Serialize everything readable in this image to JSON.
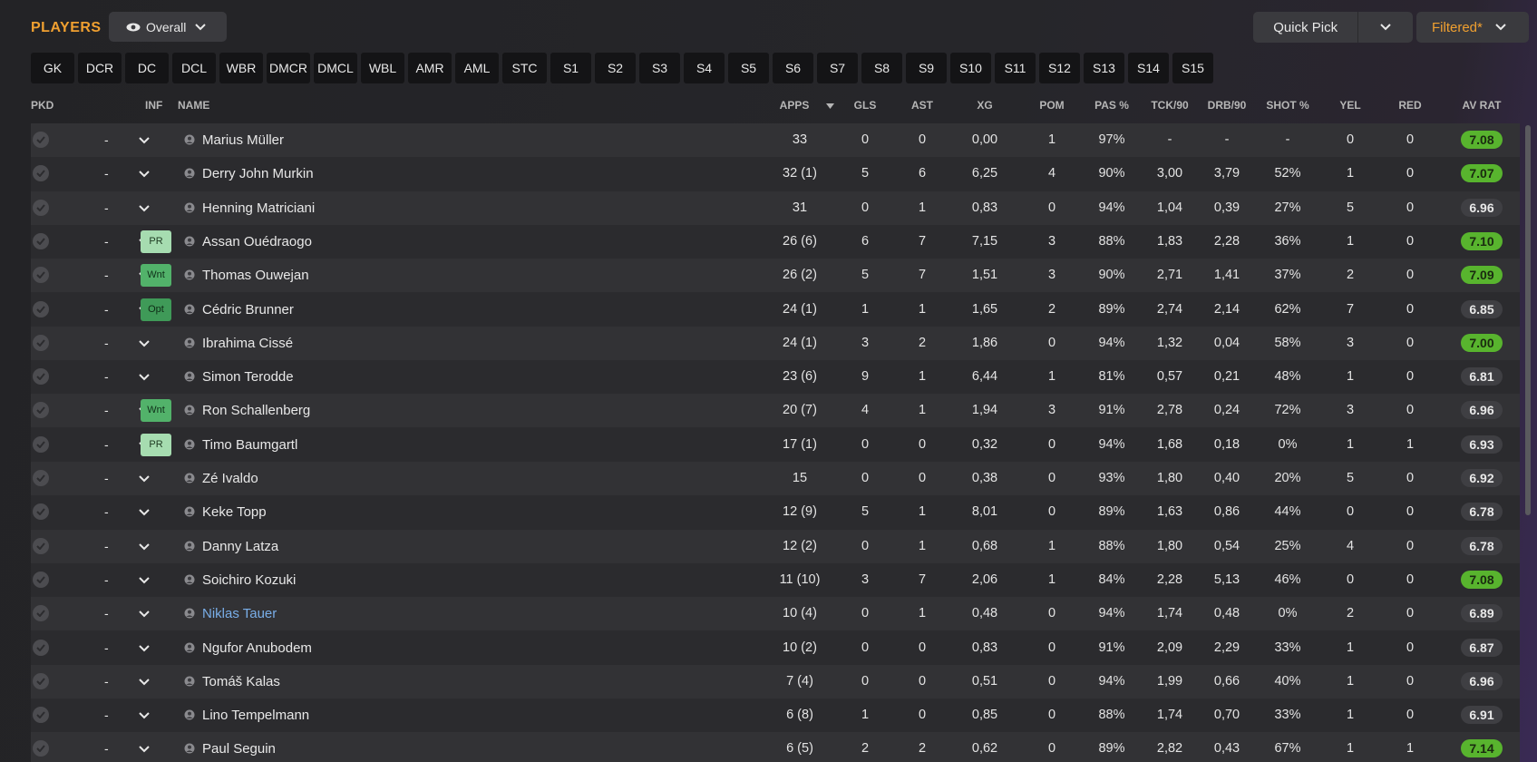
{
  "header": {
    "title": "PLAYERS",
    "view_label": "Overall",
    "quick_pick_label": "Quick Pick",
    "filter_label": "Filtered*"
  },
  "positions": [
    "GK",
    "DCR",
    "DC",
    "DCL",
    "WBR",
    "DMCR",
    "DMCL",
    "WBL",
    "AMR",
    "AML",
    "STC",
    "S1",
    "S2",
    "S3",
    "S4",
    "S5",
    "S6",
    "S7",
    "S8",
    "S9",
    "S10",
    "S11",
    "S12",
    "S13",
    "S14",
    "S15"
  ],
  "columns": {
    "pkd": "PKD",
    "inf": "INF",
    "name": "NAME",
    "apps": "APPS",
    "gls": "GLS",
    "ast": "AST",
    "xg": "XG",
    "pom": "POM",
    "pas": "PAS %",
    "tck": "TCK/90",
    "drb": "DRB/90",
    "shot": "SHOT %",
    "yel": "YEL",
    "red": "RED",
    "avrat": "AV RAT"
  },
  "players": [
    {
      "name": "Marius Müller",
      "sel": "-",
      "inf": "",
      "apps": "33",
      "gls": "0",
      "ast": "0",
      "xg": "0,00",
      "pom": "1",
      "pas": "97%",
      "tck": "-",
      "drb": "-",
      "shot": "-",
      "yel": "0",
      "red": "0",
      "rat": "7.08",
      "rat_good": true
    },
    {
      "name": "Derry John Murkin",
      "sel": "-",
      "inf": "",
      "apps": "32 (1)",
      "gls": "5",
      "ast": "6",
      "xg": "6,25",
      "pom": "4",
      "pas": "90%",
      "tck": "3,00",
      "drb": "3,79",
      "shot": "52%",
      "yel": "1",
      "red": "0",
      "rat": "7.07",
      "rat_good": true
    },
    {
      "name": "Henning Matriciani",
      "sel": "-",
      "inf": "",
      "apps": "31",
      "gls": "0",
      "ast": "1",
      "xg": "0,83",
      "pom": "0",
      "pas": "94%",
      "tck": "1,04",
      "drb": "0,39",
      "shot": "27%",
      "yel": "5",
      "red": "0",
      "rat": "6.96",
      "rat_good": false
    },
    {
      "name": "Assan Ouédraogo",
      "sel": "-",
      "inf": "PR",
      "apps": "26 (6)",
      "gls": "6",
      "ast": "7",
      "xg": "7,15",
      "pom": "3",
      "pas": "88%",
      "tck": "1,83",
      "drb": "2,28",
      "shot": "36%",
      "yel": "1",
      "red": "0",
      "rat": "7.10",
      "rat_good": true
    },
    {
      "name": "Thomas Ouwejan",
      "sel": "-",
      "inf": "Wnt",
      "apps": "26 (2)",
      "gls": "5",
      "ast": "7",
      "xg": "1,51",
      "pom": "3",
      "pas": "90%",
      "tck": "2,71",
      "drb": "1,41",
      "shot": "37%",
      "yel": "2",
      "red": "0",
      "rat": "7.09",
      "rat_good": true
    },
    {
      "name": "Cédric Brunner",
      "sel": "-",
      "inf": "Opt",
      "apps": "24 (1)",
      "gls": "1",
      "ast": "1",
      "xg": "1,65",
      "pom": "2",
      "pas": "89%",
      "tck": "2,74",
      "drb": "2,14",
      "shot": "62%",
      "yel": "7",
      "red": "0",
      "rat": "6.85",
      "rat_good": false
    },
    {
      "name": "Ibrahima Cissé",
      "sel": "-",
      "inf": "",
      "apps": "24 (1)",
      "gls": "3",
      "ast": "2",
      "xg": "1,86",
      "pom": "0",
      "pas": "94%",
      "tck": "1,32",
      "drb": "0,04",
      "shot": "58%",
      "yel": "3",
      "red": "0",
      "rat": "7.00",
      "rat_good": true
    },
    {
      "name": "Simon Terodde",
      "sel": "-",
      "inf": "",
      "apps": "23 (6)",
      "gls": "9",
      "ast": "1",
      "xg": "6,44",
      "pom": "1",
      "pas": "81%",
      "tck": "0,57",
      "drb": "0,21",
      "shot": "48%",
      "yel": "1",
      "red": "0",
      "rat": "6.81",
      "rat_good": false
    },
    {
      "name": "Ron Schallenberg",
      "sel": "-",
      "inf": "Wnt",
      "apps": "20 (7)",
      "gls": "4",
      "ast": "1",
      "xg": "1,94",
      "pom": "3",
      "pas": "91%",
      "tck": "2,78",
      "drb": "0,24",
      "shot": "72%",
      "yel": "3",
      "red": "0",
      "rat": "6.96",
      "rat_good": false
    },
    {
      "name": "Timo Baumgartl",
      "sel": "-",
      "inf": "PR",
      "apps": "17 (1)",
      "gls": "0",
      "ast": "0",
      "xg": "0,32",
      "pom": "0",
      "pas": "94%",
      "tck": "1,68",
      "drb": "0,18",
      "shot": "0%",
      "yel": "1",
      "red": "1",
      "rat": "6.93",
      "rat_good": false
    },
    {
      "name": "Zé Ivaldo",
      "sel": "-",
      "inf": "",
      "apps": "15",
      "gls": "0",
      "ast": "0",
      "xg": "0,38",
      "pom": "0",
      "pas": "93%",
      "tck": "1,80",
      "drb": "0,40",
      "shot": "20%",
      "yel": "5",
      "red": "0",
      "rat": "6.92",
      "rat_good": false
    },
    {
      "name": "Keke Topp",
      "sel": "-",
      "inf": "",
      "apps": "12 (9)",
      "gls": "5",
      "ast": "1",
      "xg": "8,01",
      "pom": "0",
      "pas": "89%",
      "tck": "1,63",
      "drb": "0,86",
      "shot": "44%",
      "yel": "0",
      "red": "0",
      "rat": "6.78",
      "rat_good": false
    },
    {
      "name": "Danny Latza",
      "sel": "-",
      "inf": "",
      "apps": "12 (2)",
      "gls": "0",
      "ast": "1",
      "xg": "0,68",
      "pom": "1",
      "pas": "88%",
      "tck": "1,80",
      "drb": "0,54",
      "shot": "25%",
      "yel": "4",
      "red": "0",
      "rat": "6.78",
      "rat_good": false
    },
    {
      "name": "Soichiro Kozuki",
      "sel": "-",
      "inf": "",
      "apps": "11 (10)",
      "gls": "3",
      "ast": "7",
      "xg": "2,06",
      "pom": "1",
      "pas": "84%",
      "tck": "2,28",
      "drb": "5,13",
      "shot": "46%",
      "yel": "0",
      "red": "0",
      "rat": "7.08",
      "rat_good": true
    },
    {
      "name": "Niklas Tauer",
      "sel": "-",
      "inf": "",
      "apps": "10 (4)",
      "gls": "0",
      "ast": "1",
      "xg": "0,48",
      "pom": "0",
      "pas": "94%",
      "tck": "1,74",
      "drb": "0,48",
      "shot": "0%",
      "yel": "2",
      "red": "0",
      "rat": "6.89",
      "rat_good": false,
      "highlight": true
    },
    {
      "name": "Ngufor Anubodem",
      "sel": "-",
      "inf": "",
      "apps": "10 (2)",
      "gls": "0",
      "ast": "0",
      "xg": "0,83",
      "pom": "0",
      "pas": "91%",
      "tck": "2,09",
      "drb": "2,29",
      "shot": "33%",
      "yel": "1",
      "red": "0",
      "rat": "6.87",
      "rat_good": false
    },
    {
      "name": "Tomáš Kalas",
      "sel": "-",
      "inf": "",
      "apps": "7 (4)",
      "gls": "0",
      "ast": "0",
      "xg": "0,51",
      "pom": "0",
      "pas": "94%",
      "tck": "1,99",
      "drb": "0,66",
      "shot": "40%",
      "yel": "1",
      "red": "0",
      "rat": "6.96",
      "rat_good": false
    },
    {
      "name": "Lino Tempelmann",
      "sel": "-",
      "inf": "",
      "apps": "6 (8)",
      "gls": "1",
      "ast": "0",
      "xg": "0,85",
      "pom": "0",
      "pas": "88%",
      "tck": "1,74",
      "drb": "0,70",
      "shot": "33%",
      "yel": "1",
      "red": "0",
      "rat": "6.91",
      "rat_good": false
    },
    {
      "name": "Paul Seguin",
      "sel": "-",
      "inf": "",
      "apps": "6 (5)",
      "gls": "2",
      "ast": "2",
      "xg": "0,62",
      "pom": "0",
      "pas": "89%",
      "tck": "2,82",
      "drb": "0,43",
      "shot": "67%",
      "yel": "1",
      "red": "1",
      "rat": "7.14",
      "rat_good": true
    }
  ],
  "colors": {
    "accent": "#f0a030",
    "rating_good": "#58b42e",
    "rating_neutral": "#3f3f43",
    "link": "#79aee8"
  }
}
